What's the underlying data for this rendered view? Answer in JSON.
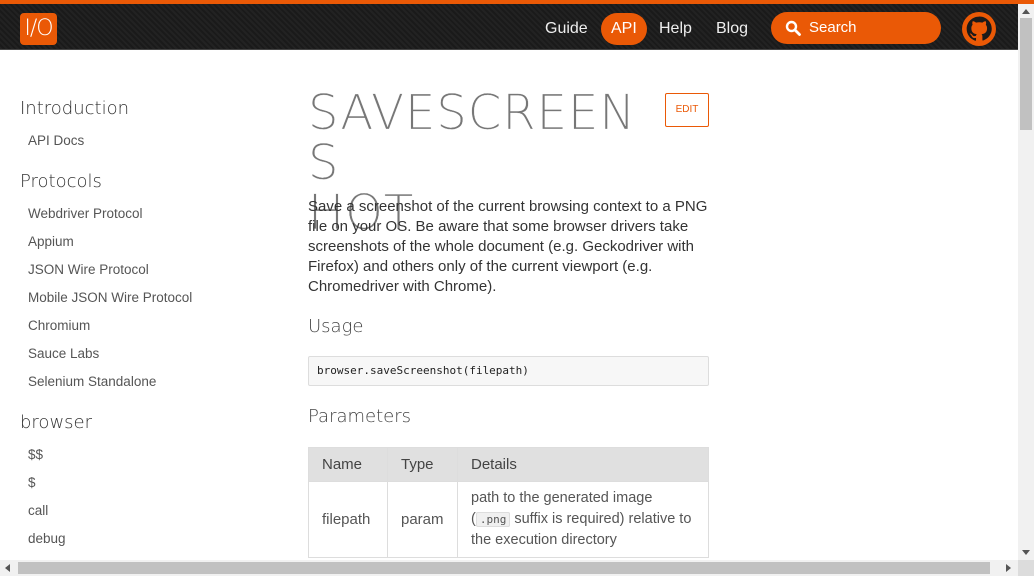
{
  "header": {
    "logo": "I/O",
    "nav": [
      {
        "label": "Guide"
      },
      {
        "label": "API",
        "active": true
      },
      {
        "label": "Help"
      },
      {
        "label": "Blog"
      }
    ],
    "search_label": "Search",
    "accent_color": "#ea5906"
  },
  "sidebar": {
    "sections": [
      {
        "heading": "Introduction",
        "items": [
          "API Docs"
        ]
      },
      {
        "heading": "Protocols",
        "items": [
          "Webdriver Protocol",
          "Appium",
          "JSON Wire Protocol",
          "Mobile JSON Wire Protocol",
          "Chromium",
          "Sauce Labs",
          "Selenium Standalone"
        ]
      },
      {
        "heading": "browser",
        "items": [
          "$$",
          "$",
          "call",
          "debug"
        ]
      }
    ]
  },
  "main": {
    "title_line1": "SAVESCREENS",
    "title_line2": "HOT",
    "edit_label": "EDIT",
    "description": "Save a screenshot of the current browsing context to a PNG file on your OS. Be aware that some browser drivers take screenshots of the whole document (e.g. Geckodriver with Firefox) and others only of the current viewport (e.g. Chromedriver with Chrome).",
    "usage_heading": "Usage",
    "usage_code": "browser.saveScreenshot(filepath)",
    "parameters_heading": "Parameters",
    "params_table": {
      "headers": [
        "Name",
        "Type",
        "Details"
      ],
      "rows": [
        {
          "name": "filepath",
          "type": "param",
          "details_pre": "path to the generated image (",
          "details_code": ".png",
          "details_post": " suffix is required) relative to the execution directory"
        }
      ]
    }
  }
}
